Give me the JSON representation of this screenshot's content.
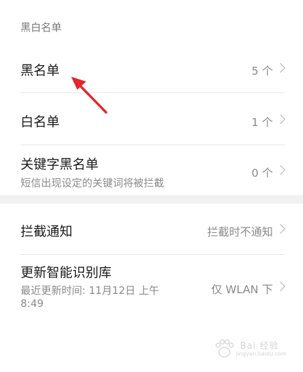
{
  "section": {
    "header": "黑白名单"
  },
  "rows": {
    "blacklist": {
      "title": "黑名单",
      "value": "5 个"
    },
    "whitelist": {
      "title": "白名单",
      "value": "1 个"
    },
    "keyword": {
      "title": "关键字黑名单",
      "subtitle": "短信出现设定的关键词将被拦截",
      "value": "0 个"
    },
    "notify": {
      "title": "拦截通知",
      "value": "拦截时不通知"
    },
    "update": {
      "title": "更新智能识别库",
      "subtitle_line1": "最近更新时间: 11月12日 上午",
      "subtitle_line2": "8:49",
      "value": "仅 WLAN 下"
    }
  },
  "watermark": {
    "text": "Bai 经验",
    "url": "jingyan.baidu.com"
  },
  "colors": {
    "arrow": "#e0282d",
    "secondary_text": "#8a8a8a",
    "divider": "#e6e6e6"
  }
}
